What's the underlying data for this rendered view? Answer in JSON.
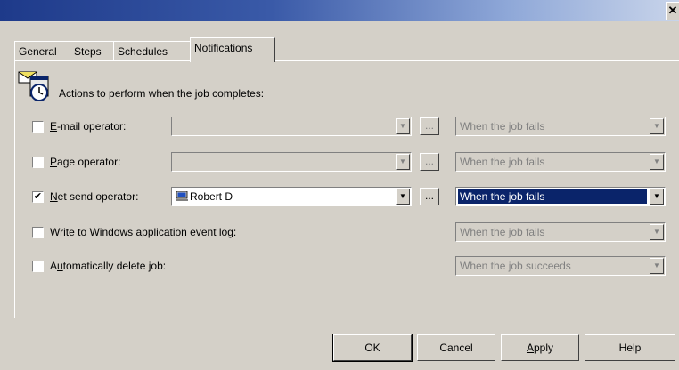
{
  "window": {
    "close_label": "✕"
  },
  "tabs": [
    {
      "label": "General"
    },
    {
      "label": "Steps"
    },
    {
      "label": "Schedules"
    },
    {
      "label": "Notifications"
    }
  ],
  "header": {
    "text": "Actions to perform when the job completes:",
    "icon": "notification-clock-icon"
  },
  "rows": {
    "email": {
      "checked": false,
      "label_pre": "",
      "label_u": "E",
      "label_post": "-mail operator:",
      "operator_value": "",
      "condition": "When the job fails"
    },
    "page": {
      "checked": false,
      "label_pre": "",
      "label_u": "P",
      "label_post": "age operator:",
      "operator_value": "",
      "condition": "When the job fails"
    },
    "netsend": {
      "checked": true,
      "label_pre": "",
      "label_u": "N",
      "label_post": "et send operator:",
      "operator_value": "Robert D",
      "condition": "When the job fails"
    },
    "eventlog": {
      "checked": false,
      "label_pre": "",
      "label_u": "W",
      "label_post": "rite to Windows application event log:",
      "condition": "When the job fails"
    },
    "delete": {
      "checked": false,
      "label_pre": "A",
      "label_u": "u",
      "label_post": "tomatically delete job:",
      "condition": "When the job succeeds"
    }
  },
  "ellipsis_label": "...",
  "buttons": {
    "ok": "OK",
    "cancel": "Cancel",
    "apply_u": "A",
    "apply_rest": "pply",
    "help": "Help"
  }
}
